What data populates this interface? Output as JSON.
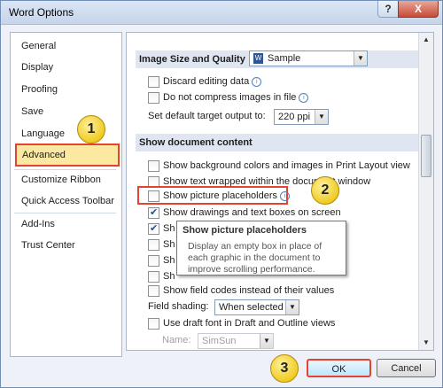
{
  "window": {
    "title": "Word Options",
    "help_glyph": "?",
    "close_glyph": "X"
  },
  "nav": {
    "items": [
      {
        "id": "general",
        "label": "General"
      },
      {
        "id": "display",
        "label": "Display"
      },
      {
        "id": "proofing",
        "label": "Proofing"
      },
      {
        "id": "save",
        "label": "Save"
      },
      {
        "id": "language",
        "label": "Language"
      },
      {
        "id": "advanced",
        "label": "Advanced",
        "selected": true
      },
      {
        "id": "customize-ribbon",
        "label": "Customize Ribbon"
      },
      {
        "id": "quick-access-toolbar",
        "label": "Quick Access Toolbar"
      },
      {
        "id": "add-ins",
        "label": "Add-Ins"
      },
      {
        "id": "trust-center",
        "label": "Trust Center"
      }
    ]
  },
  "image_section": {
    "title": "Image Size and Quality",
    "document_select": "Sample",
    "discard_editing": {
      "label": "Discard editing data",
      "checked": false
    },
    "no_compress": {
      "label": "Do not compress images in file",
      "checked": false
    },
    "target_output_label": "Set default target output to:",
    "target_output_value": "220 ppi"
  },
  "show_section": {
    "title": "Show document content",
    "options": [
      {
        "label": "Show background colors and images in Print Layout view",
        "checked": false
      },
      {
        "label": "Show text wrapped within the document window",
        "checked": false
      },
      {
        "label": "Show picture placeholders",
        "checked": false
      },
      {
        "label": "Show drawings and text boxes on screen",
        "checked": true
      },
      {
        "label": "Sh",
        "checked": true
      },
      {
        "label": "Sh",
        "checked": false
      },
      {
        "label": "Sh",
        "checked": false
      },
      {
        "label": "Sh",
        "checked": false
      },
      {
        "label": "Show field codes instead of their values",
        "checked": false
      }
    ],
    "field_shading_label": "Field shading:",
    "field_shading_value": "When selected",
    "draft_font": {
      "label": "Use draft font in Draft and Outline views",
      "checked": false
    },
    "name_label": "Name:",
    "name_value": "SimSun"
  },
  "tooltip": {
    "title": "Show picture placeholders",
    "body": "Display an empty box in place of each graphic in the document to improve scrolling performance."
  },
  "callouts": {
    "one": "1",
    "two": "2",
    "three": "3"
  },
  "footer": {
    "ok_label": "OK",
    "cancel_label": "Cancel"
  }
}
